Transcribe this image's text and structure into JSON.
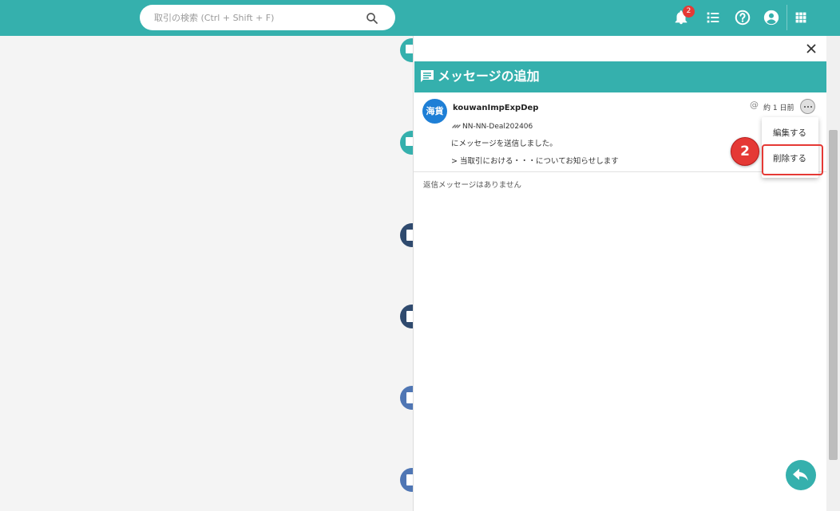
{
  "header": {
    "search": {
      "placeholder": "取引の検索 (Ctrl + Shift + F)"
    },
    "notifications": {
      "count": "2"
    },
    "icons": [
      "bell-icon",
      "list-icon",
      "help-icon",
      "account-icon",
      "apps-grid-icon"
    ]
  },
  "panel": {
    "title": "メッセージの追加",
    "message": {
      "avatar_text": "海貨",
      "author": "kouwanImpExpDep",
      "mention_symbol": "@",
      "timestamp": "約 1 日前",
      "deal": "NN-NN-Deal202406",
      "line1": "にメッセージを送信しました。",
      "line2": "> 当取引における・・・についてお知らせします"
    },
    "no_replies": "返信メッセージはありません"
  },
  "menu": {
    "edit": "編集する",
    "delete": "削除する"
  },
  "annotation": {
    "step": "2"
  },
  "colors": {
    "teal": "#35b0ad",
    "avatar_blue": "#1e7fd6",
    "annotation_red": "#e53935"
  }
}
